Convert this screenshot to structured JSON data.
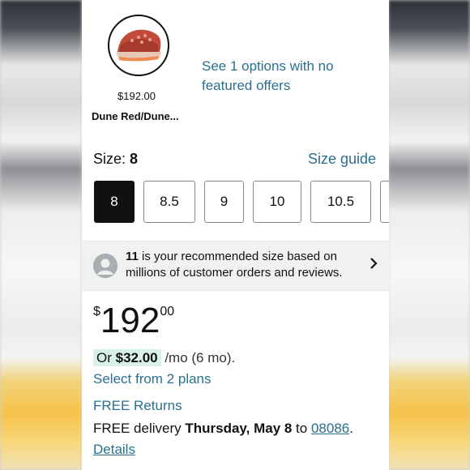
{
  "product": {
    "thumbnail_icon": "sneaker-icon",
    "price": "$192.00",
    "variant_name": "Dune Red/Dune...",
    "see_options": "See 1 options with no featured offers"
  },
  "size": {
    "label": "Size:",
    "selected": "8",
    "guide": "Size guide",
    "options": [
      "8",
      "8.5",
      "9",
      "10",
      "10.5"
    ]
  },
  "recommendation": {
    "size": "11",
    "line1": " is your recommended size based on",
    "line2": "millions of customer orders and reviews.",
    "avatar_icon": "user-avatar-icon",
    "chevron_icon": "chevron-right-icon"
  },
  "price": {
    "currency": "$",
    "whole": "192",
    "fraction": "00"
  },
  "installment": {
    "or": "Or ",
    "amount": "$32.00",
    "rest": " /mo (6 mo).",
    "select_plans": "Select from 2 plans"
  },
  "shipping": {
    "free_returns": "FREE Returns",
    "delivery_prefix": "FREE delivery ",
    "delivery_date": "Thursday, May 8",
    "to": " to ",
    "zip": "08086",
    "period": ".",
    "details": "Details"
  },
  "colors": {
    "link": "#2a6f8f",
    "installment_highlight": "#d8f1e8",
    "selected_size_bg": "#111111"
  }
}
